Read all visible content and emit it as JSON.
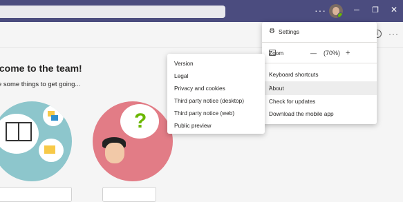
{
  "titlebar": {
    "more_label": "···",
    "minimize": "–",
    "restore": "❐",
    "close": "✕"
  },
  "header": {
    "info": "i",
    "more": "···"
  },
  "welcome": {
    "title": "lcome to the team!",
    "subtitle": "e some things to get going..."
  },
  "settings_menu": {
    "settings": "Settings",
    "zoom_label": "Zoom",
    "zoom_minus": "—",
    "zoom_value": "(70%)",
    "zoom_plus": "+",
    "keyboard_shortcuts": "Keyboard shortcuts",
    "about": "About",
    "check_updates": "Check for updates",
    "download_mobile": "Download the mobile app"
  },
  "about_submenu": {
    "items": [
      "Version",
      "Legal",
      "Privacy and cookies",
      "Third party notice (desktop)",
      "Third party notice (web)",
      "Public preview"
    ]
  },
  "colors": {
    "titlebar": "#4b4c7f",
    "teal_circle": "#8dc6cc",
    "pink_circle": "#e27c86",
    "presence": "#6bb700"
  }
}
